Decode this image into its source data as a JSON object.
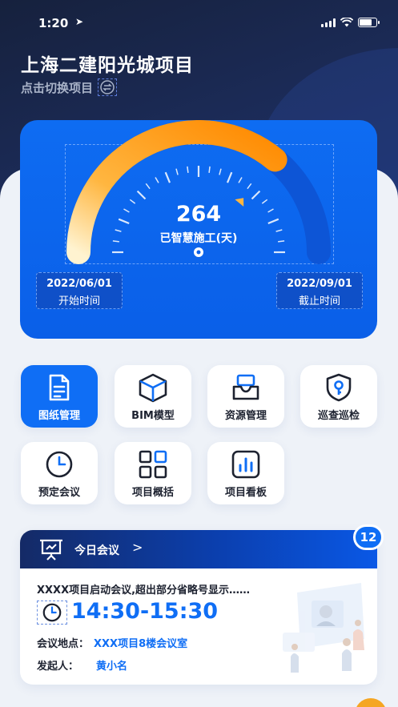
{
  "status_bar": {
    "time": "1:20",
    "location_arrow": "➤"
  },
  "header": {
    "project_title": "上海二建阳光城项目",
    "switch_label": "点击切换项目"
  },
  "gauge": {
    "value": "264",
    "label": "已智慧施工(天)",
    "progress_fraction": 0.72,
    "start_date": "2022/06/01",
    "start_label": "开始时间",
    "end_date": "2022/09/01",
    "end_label": "截止时间"
  },
  "grid": {
    "items": [
      {
        "label": "图纸管理",
        "icon": "document-icon"
      },
      {
        "label": "BIM模型",
        "icon": "cube-icon"
      },
      {
        "label": "资源管理",
        "icon": "inbox-icon"
      },
      {
        "label": "巡查巡检",
        "icon": "shield-key-icon"
      },
      {
        "label": "预定会议",
        "icon": "clock-icon"
      },
      {
        "label": "项目概括",
        "icon": "grid-icon"
      },
      {
        "label": "项目看板",
        "icon": "bar-chart-icon"
      }
    ]
  },
  "meeting": {
    "header_title": "今日会议",
    "chevron": ">",
    "count": "12",
    "subject": "XXXX项目启动会议,超出部分省略号显示……",
    "time_range": "14:30-15:30",
    "location_label": "会议地点：",
    "location_value": "XXX项目8楼会议室",
    "initiator_label": "发起人：",
    "initiator_value": "黄小名"
  },
  "colors": {
    "accent": "#0f6ef5",
    "gauge_orange": "#ff8a00",
    "header_dark": "#16213d"
  }
}
